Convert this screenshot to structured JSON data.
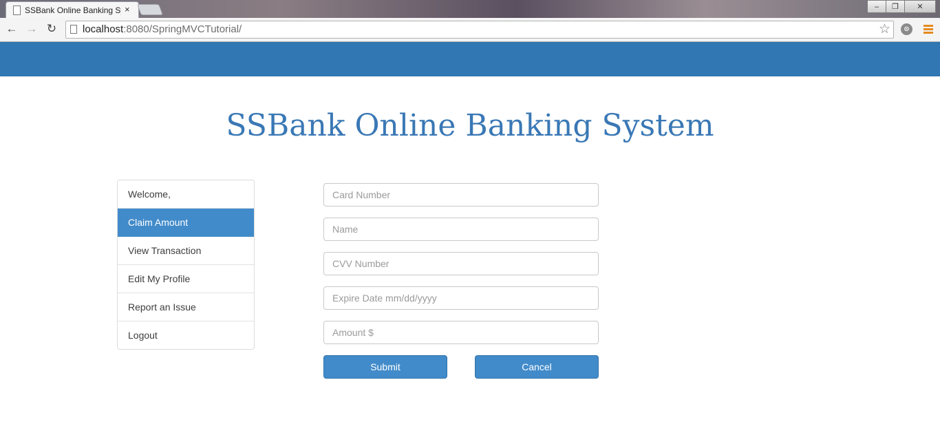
{
  "browser": {
    "tab_title": "SSBank Online Banking Sy",
    "tab_close": "×",
    "url_host": "localhost",
    "url_rest": ":8080/SpringMVCTutorial/",
    "back_glyph": "←",
    "forward_glyph": "→",
    "reload_glyph": "↻",
    "star_glyph": "☆",
    "window_controls": [
      "–",
      "❐",
      "✕"
    ]
  },
  "page": {
    "title": "SSBank Online Banking System"
  },
  "sidebar": {
    "items": [
      {
        "label": "Welcome,"
      },
      {
        "label": "Claim Amount",
        "active": true
      },
      {
        "label": "View Transaction"
      },
      {
        "label": "Edit My Profile"
      },
      {
        "label": "Report an Issue"
      },
      {
        "label": "Logout"
      }
    ]
  },
  "form": {
    "card_number_placeholder": "Card Number",
    "name_placeholder": "Name",
    "cvv_placeholder": "CVV Number",
    "expire_placeholder": "Expire Date mm/dd/yyyy",
    "amount_placeholder": "Amount $",
    "submit_label": "Submit",
    "cancel_label": "Cancel"
  },
  "colors": {
    "navbar": "#3077b3",
    "accent": "#428bca",
    "title": "#3a78b5"
  }
}
